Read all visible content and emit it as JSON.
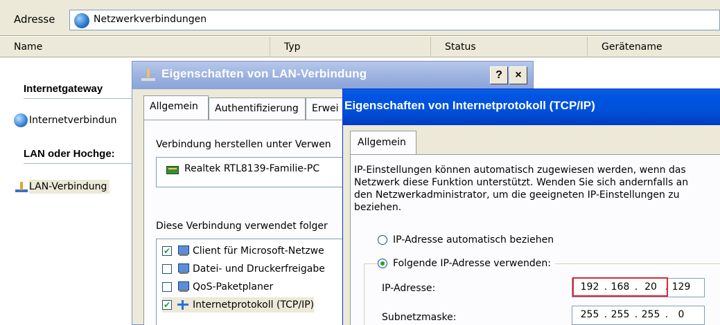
{
  "address_bar": {
    "label": "Adresse",
    "value": "Netzwerkverbindungen"
  },
  "columns": [
    "Name",
    "Typ",
    "Status",
    "Gerätename"
  ],
  "left_pane": {
    "group1": "Internetgateway",
    "item1": "Internetverbindun",
    "group2": "LAN oder Hochge:",
    "item2": "LAN-Verbindung"
  },
  "dialog_lan": {
    "title": "Eigenschaften von LAN-Verbindung",
    "help_button": "?",
    "close_button": "×",
    "tabs": [
      "Allgemein",
      "Authentifizierung",
      "Erwei"
    ],
    "connect_using_label": "Verbindung herstellen unter Verwen",
    "adapter": "Realtek RTL8139-Familie-PC",
    "components_label": "Diese Verbindung verwendet folger",
    "components": [
      {
        "label": "Client für Microsoft-Netzwe",
        "checked": true
      },
      {
        "label": "Datei- und Druckerfreigabe",
        "checked": false
      },
      {
        "label": "QoS-Paketplaner",
        "checked": false
      },
      {
        "label": "Internetprotokoll (TCP/IP)",
        "checked": true
      }
    ]
  },
  "dialog_tcpip": {
    "title": "Eigenschaften von Internetprotokoll (TCP/IP)",
    "tab": "Allgemein",
    "description_lines": [
      "IP-Einstellungen können automatisch zugewiesen werden, wenn das",
      "Netzwerk diese Funktion unterstützt. Wenden Sie sich andernfalls an",
      "den Netzwerkadministrator, um die geeigneten IP-Einstellungen zu",
      "beziehen."
    ],
    "radio_auto": "IP-Adresse automatisch beziehen",
    "radio_manual": "Folgende IP-Adresse verwenden:",
    "selected_radio": "manual",
    "ip_label": "IP-Adresse:",
    "ip_octets": [
      "192",
      "168",
      "20",
      "129"
    ],
    "subnet_label": "Subnetzmaske:",
    "subnet_octets": [
      "255",
      "255",
      "255",
      "0"
    ]
  },
  "colors": {
    "highlight_border": "#e0252f",
    "active_title": "#0054e3",
    "inactive_title": "#9db3e0"
  }
}
